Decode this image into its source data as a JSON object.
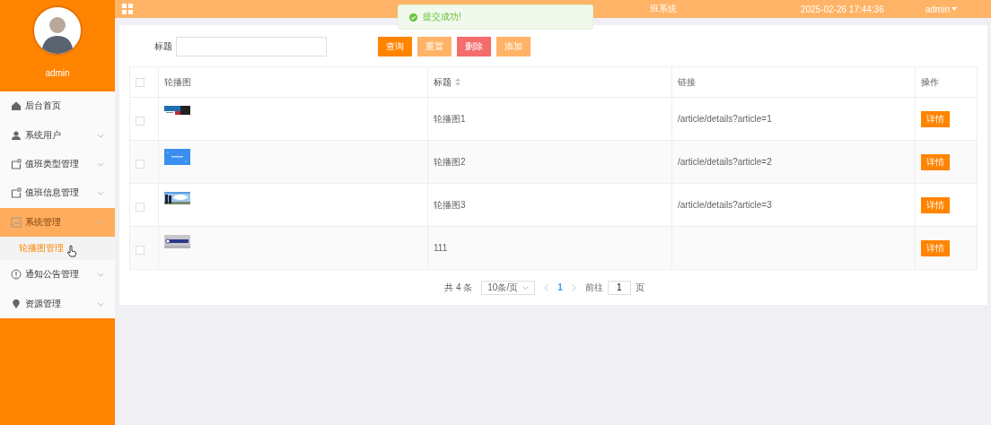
{
  "sidebar": {
    "username": "admin",
    "items": [
      {
        "label": "后台首页",
        "selected": false
      },
      {
        "label": "系统用户",
        "expanded": false,
        "selected": false
      },
      {
        "label": "值班类型管理",
        "expanded": false,
        "selected": false
      },
      {
        "label": "值班信息管理",
        "expanded": false,
        "selected": false
      },
      {
        "label": "系统管理",
        "expanded": true,
        "selected": true,
        "children": [
          {
            "label": "轮播图管理",
            "selected": true
          }
        ]
      },
      {
        "label": "通知公告管理",
        "expanded": false,
        "selected": false
      },
      {
        "label": "资源管理",
        "expanded": false,
        "selected": false
      }
    ]
  },
  "header": {
    "title": "班系统",
    "datetime": "2025-02-26 17:44:36",
    "user": "admin"
  },
  "toast": {
    "kind": "success",
    "message": "提交成功!"
  },
  "search": {
    "label": "标题",
    "buttons": [
      {
        "label": "查询",
        "kind": "primary"
      },
      {
        "label": "重置",
        "kind": "light"
      },
      {
        "label": "删除",
        "kind": "danger"
      },
      {
        "label": "添加",
        "kind": "light"
      }
    ]
  },
  "table": {
    "all_checked": false,
    "columns": [
      {
        "label": "轮播图",
        "sortable": false
      },
      {
        "label": "标题",
        "sortable": true
      },
      {
        "label": "链接",
        "sortable": false
      },
      {
        "label": "操作",
        "sortable": false
      }
    ],
    "rows": [
      {
        "checked": false,
        "title": "轮播图1",
        "link": "/article/details?article=1",
        "action": "详情"
      },
      {
        "checked": false,
        "title": "轮播图2",
        "link": "/article/details?article=2",
        "action": "详情"
      },
      {
        "checked": false,
        "title": "轮播图3",
        "link": "/article/details?article=3",
        "action": "详情"
      },
      {
        "checked": false,
        "title": "111",
        "action": "详情"
      }
    ]
  },
  "pagination": {
    "total": "共 4 条",
    "page_size": "10条/页",
    "pages": [
      {
        "label": "1",
        "selected": true
      }
    ],
    "goto_label": "前往",
    "goto_value": "1",
    "goto_suffix": "页"
  }
}
